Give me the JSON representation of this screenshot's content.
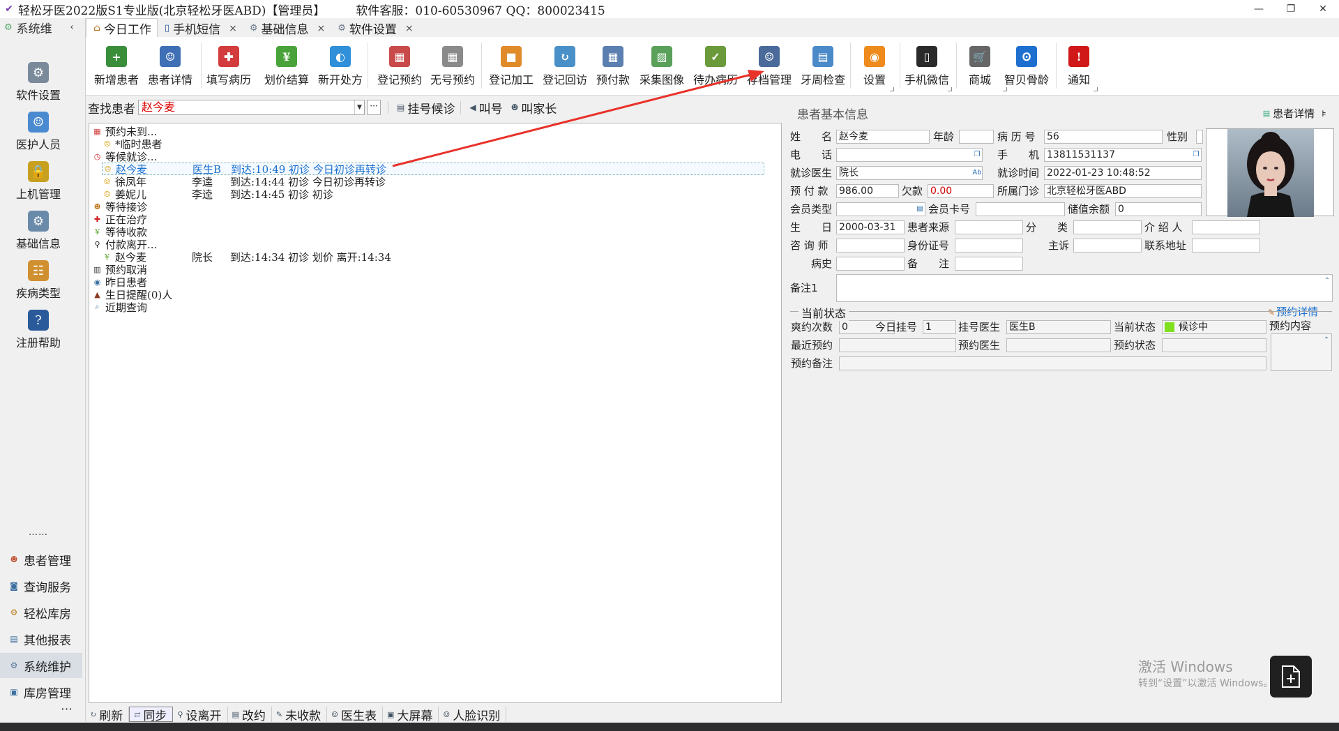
{
  "window": {
    "title": "轻松牙医2022版S1专业版(北京轻松牙医ABD)【管理员】",
    "service": "软件客服：010-60530967 QQ：800023415",
    "controls": [
      "—",
      "❐",
      "✕"
    ]
  },
  "sidebar": {
    "header": "系统维",
    "items": [
      {
        "label": "软件设置",
        "icon": "gears-icon"
      },
      {
        "label": "医护人员",
        "icon": "staff-icon"
      },
      {
        "label": "上机管理",
        "icon": "lock-icon"
      },
      {
        "label": "基础信息",
        "icon": "settings-doc-icon"
      },
      {
        "label": "疾病类型",
        "icon": "tree-icon"
      },
      {
        "label": "注册帮助",
        "icon": "help-icon"
      }
    ],
    "dots": "……",
    "nav": [
      {
        "label": "患者管理",
        "icon": "patients-icon"
      },
      {
        "label": "查询服务",
        "icon": "query-icon"
      },
      {
        "label": "轻松库房",
        "icon": "warehouse-icon"
      },
      {
        "label": "其他报表",
        "icon": "report-icon"
      },
      {
        "label": "系统维护",
        "icon": "gears-icon"
      },
      {
        "label": "库房管理",
        "icon": "storage-icon"
      }
    ],
    "more": "⋯"
  },
  "tabs": [
    {
      "label": "今日工作",
      "closable": false
    },
    {
      "label": "手机短信",
      "closable": true
    },
    {
      "label": "基础信息",
      "closable": true
    },
    {
      "label": "软件设置",
      "closable": true
    }
  ],
  "toolbar": [
    {
      "label": "新增患者",
      "icon": "add-patient-icon",
      "color": "#3a8e3a"
    },
    {
      "label": "患者详情",
      "icon": "patient-detail-icon",
      "color": "#3f6fb5"
    },
    {
      "label": "填写病历",
      "icon": "medical-record-icon",
      "color": "#d23c3c"
    },
    {
      "label": "划价结算",
      "icon": "yen-icon",
      "color": "#4aa33a"
    },
    {
      "label": "新开处方",
      "icon": "pill-icon",
      "color": "#2f8fd8"
    },
    {
      "label": "登记预约",
      "icon": "calendar-icon",
      "color": "#c84a4a"
    },
    {
      "label": "无号预约",
      "icon": "calendar-grid-icon",
      "color": "#8a8a8a"
    },
    {
      "label": "登记加工",
      "icon": "cubes-icon",
      "color": "#e08a2a"
    },
    {
      "label": "登记回访",
      "icon": "refresh-icon",
      "color": "#4a90c8"
    },
    {
      "label": "预付款",
      "icon": "calculator-icon",
      "color": "#5a7fb0"
    },
    {
      "label": "采集图像",
      "icon": "image-icon",
      "color": "#5aa05a"
    },
    {
      "label": "待办病历",
      "icon": "checklist-icon",
      "color": "#6a9a3a"
    },
    {
      "label": "存档管理",
      "icon": "archive-user-icon",
      "color": "#4a6a9a"
    },
    {
      "label": "牙周检查",
      "icon": "clipboard-icon",
      "color": "#4a8ac8"
    },
    {
      "label": "设置",
      "icon": "rss-icon",
      "color": "#ef8a1c"
    },
    {
      "label": "手机微信",
      "icon": "phone-icon",
      "color": "#2a2a2a"
    },
    {
      "label": "商城",
      "icon": "cart-icon",
      "color": "#666666"
    },
    {
      "label": "智贝骨龄",
      "icon": "logo-icon",
      "color": "#1d6fd0"
    },
    {
      "label": "通知",
      "icon": "alert-icon",
      "color": "#d01818"
    }
  ],
  "search": {
    "label": "查找患者",
    "value": "赵今麦",
    "more": "···",
    "buttons": [
      "挂号候诊",
      "叫号",
      "叫家长"
    ]
  },
  "tree": [
    {
      "icon": "calendar-icon",
      "color": "#d04040",
      "indent": 0,
      "label": "预约未到...",
      "sel": false
    },
    {
      "icon": "smile-icon",
      "color": "#e0a820",
      "indent": 1,
      "label": "*临时患者",
      "sel": false
    },
    {
      "icon": "clock-icon",
      "color": "#d03030",
      "indent": 0,
      "label": "等候就诊...",
      "sel": false
    },
    {
      "icon": "smile-icon",
      "color": "#e0a820",
      "indent": 1,
      "label": "赵今麦",
      "c2": "医生B",
      "c3": "到达:10:49 初诊 今日初诊再转诊",
      "sel": true
    },
    {
      "icon": "smile-icon",
      "color": "#e0a820",
      "indent": 1,
      "label": "徐凤年",
      "c2": "李逵",
      "c3": "到达:14:44 初诊 今日初诊再转诊",
      "sel": false
    },
    {
      "icon": "smile-icon",
      "color": "#e0a820",
      "indent": 1,
      "label": "姜妮儿",
      "c2": "李逵",
      "c3": "到达:14:45 初诊 初诊",
      "sel": false
    },
    {
      "icon": "reception-icon",
      "color": "#c07a20",
      "indent": 0,
      "label": "等待接诊",
      "sel": false
    },
    {
      "icon": "treatment-icon",
      "color": "#d02020",
      "indent": 0,
      "label": "正在治疗",
      "sel": false
    },
    {
      "icon": "money-icon",
      "color": "#6aaa40",
      "indent": 0,
      "label": "等待收款",
      "sel": false
    },
    {
      "icon": "walk-icon",
      "color": "#222222",
      "indent": 0,
      "label": "付款离开...",
      "sel": false
    },
    {
      "icon": "money-icon",
      "color": "#6aaa40",
      "indent": 1,
      "label": "赵今麦",
      "c2": "院长",
      "c3": "到达:14:34 初诊 划价 离开:14:34",
      "sel": false
    },
    {
      "icon": "cancel-icon",
      "color": "#333333",
      "indent": 0,
      "label": "预约取消",
      "sel": false
    },
    {
      "icon": "eye-icon",
      "color": "#3a6fa0",
      "indent": 0,
      "label": "昨日患者",
      "sel": false
    },
    {
      "icon": "cake-icon",
      "color": "#8a3a20",
      "indent": 0,
      "label": "生日提醒(0)人",
      "sel": false
    },
    {
      "icon": "search-icon",
      "color": "#3a6fa0",
      "indent": 0,
      "label": "近期查询",
      "sel": false
    }
  ],
  "patient": {
    "title": "患者基本信息",
    "detail_link": "患者详情",
    "pin": "⊧",
    "labels": {
      "name": "姓　　名",
      "age": "年龄",
      "record_no": "病 历 号",
      "gender": "性别",
      "phone": "电　　话",
      "mobile": "手　　机",
      "doctor": "就诊医生",
      "visit_time": "就诊时间",
      "prepay": "预 付 款",
      "debt": "欠款",
      "clinic": "所属门诊",
      "member_type": "会员类型",
      "member_card": "会员卡号",
      "balance": "储值余额",
      "birthday": "生　　日",
      "source": "患者来源",
      "category": "分　　类",
      "referrer": "介 绍 人",
      "consultant": "咨 询 师",
      "id_card": "身份证号",
      "complaint": "主诉",
      "address": "联系地址",
      "history": "病史",
      "note": "备　　注",
      "remark1": "备注1"
    },
    "values": {
      "name": "赵今麦",
      "age": "",
      "record_no": "56",
      "gender": "",
      "phone": "",
      "mobile": "13811531137",
      "doctor": "院长",
      "visit_time": "2022-01-23 10:48:52",
      "prepay": "986.00",
      "debt": "0.00",
      "clinic": "北京轻松牙医ABD",
      "member_type": "",
      "member_card": "",
      "balance": "0",
      "birthday": "2000-03-31",
      "source": "",
      "category": "",
      "referrer": "",
      "consultant": "",
      "id_card": "",
      "complaint": "",
      "address": "",
      "history": "",
      "note": "",
      "remark1": ""
    }
  },
  "status": {
    "legend": "当前状态",
    "detail_link": "预约详情",
    "labels": {
      "missed": "爽约次数",
      "today_reg": "今日挂号",
      "reg_doctor": "挂号医生",
      "state": "当前状态",
      "content": "预约内容",
      "recent": "最近预约",
      "appt_doctor": "预约医生",
      "appt_state": "预约状态",
      "appt_note": "预约备注"
    },
    "values": {
      "missed": "0",
      "today_reg": "1",
      "reg_doctor": "医生B",
      "state": "候诊中",
      "recent": "",
      "appt_doctor": "",
      "appt_state": "",
      "appt_note": ""
    },
    "state_color": "#80e020"
  },
  "bottombar": [
    {
      "label": "刷新",
      "icon": "refresh-icon"
    },
    {
      "label": "同步",
      "icon": "sync-icon"
    },
    {
      "label": "设离开",
      "icon": "walk-icon"
    },
    {
      "label": "改约",
      "icon": "edit-appointment-icon"
    },
    {
      "label": "未收款",
      "icon": "unpaid-icon"
    },
    {
      "label": "医生表",
      "icon": "doctor-table-icon"
    },
    {
      "label": "大屏幕",
      "icon": "big-screen-icon"
    },
    {
      "label": "人脸识别",
      "icon": "face-icon"
    }
  ],
  "watermark": {
    "line1": "激活 Windows",
    "line2": "转到“设置”以激活 Windows。"
  },
  "colors": {
    "accent": "#1a6fd0",
    "arrow": "#e8322a",
    "debt": "#d00000"
  }
}
